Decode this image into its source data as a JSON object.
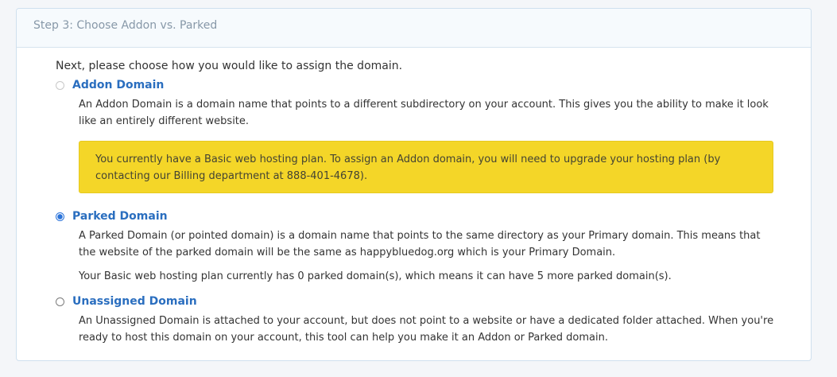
{
  "step": {
    "title": "Step 3: Choose Addon vs. Parked",
    "intro": "Next, please choose how you would like to assign the domain."
  },
  "options": [
    {
      "title": "Addon Domain",
      "state": "disabled",
      "description": "An Addon Domain is a domain name that points to a different subdirectory on your account. This gives you the ability to make it look like an entirely different website.",
      "warning": "You currently have a Basic web hosting plan. To assign an Addon domain, you will need to upgrade your hosting plan (by contacting our Billing department at 888-401-4678)."
    },
    {
      "title": "Parked Domain",
      "state": "selected",
      "description": "A Parked Domain (or pointed domain) is a domain name that points to the same directory as your Primary domain. This means that the website of the parked domain will be the same as happybluedog.org which is your Primary Domain.",
      "note": "Your Basic web hosting plan currently has 0 parked domain(s), which means it can have 5 more parked domain(s)."
    },
    {
      "title": "Unassigned Domain",
      "state": "unselected",
      "description": "An Unassigned Domain is attached to your account, but does not point to a website or have a dedicated folder attached. When you're ready to host this domain on your account, this tool can help you make it an Addon or Parked domain."
    }
  ],
  "colors": {
    "link_blue": "#2a6ebf",
    "warning_yellow": "#f4d628",
    "panel_border": "#cfe0ee"
  }
}
